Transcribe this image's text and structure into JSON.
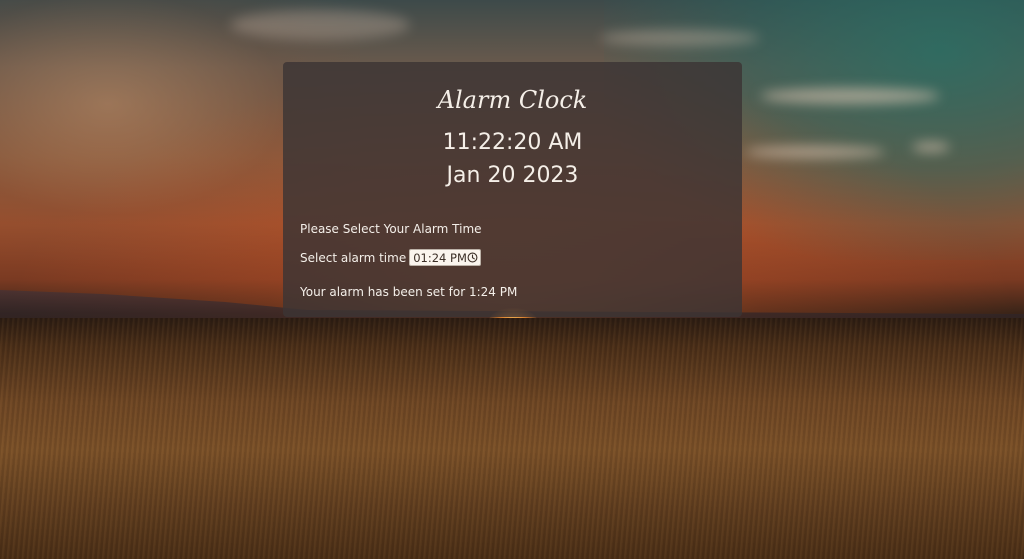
{
  "app": {
    "title": "Alarm Clock",
    "current_time": "11:22:20 AM",
    "current_date": "Jan 20 2023"
  },
  "alarm": {
    "prompt": "Please Select Your Alarm Time",
    "field_label": "Select alarm time",
    "value": "01:24  PM",
    "icon": "clock-icon",
    "status": "Your alarm has been set for 1:24 PM"
  }
}
